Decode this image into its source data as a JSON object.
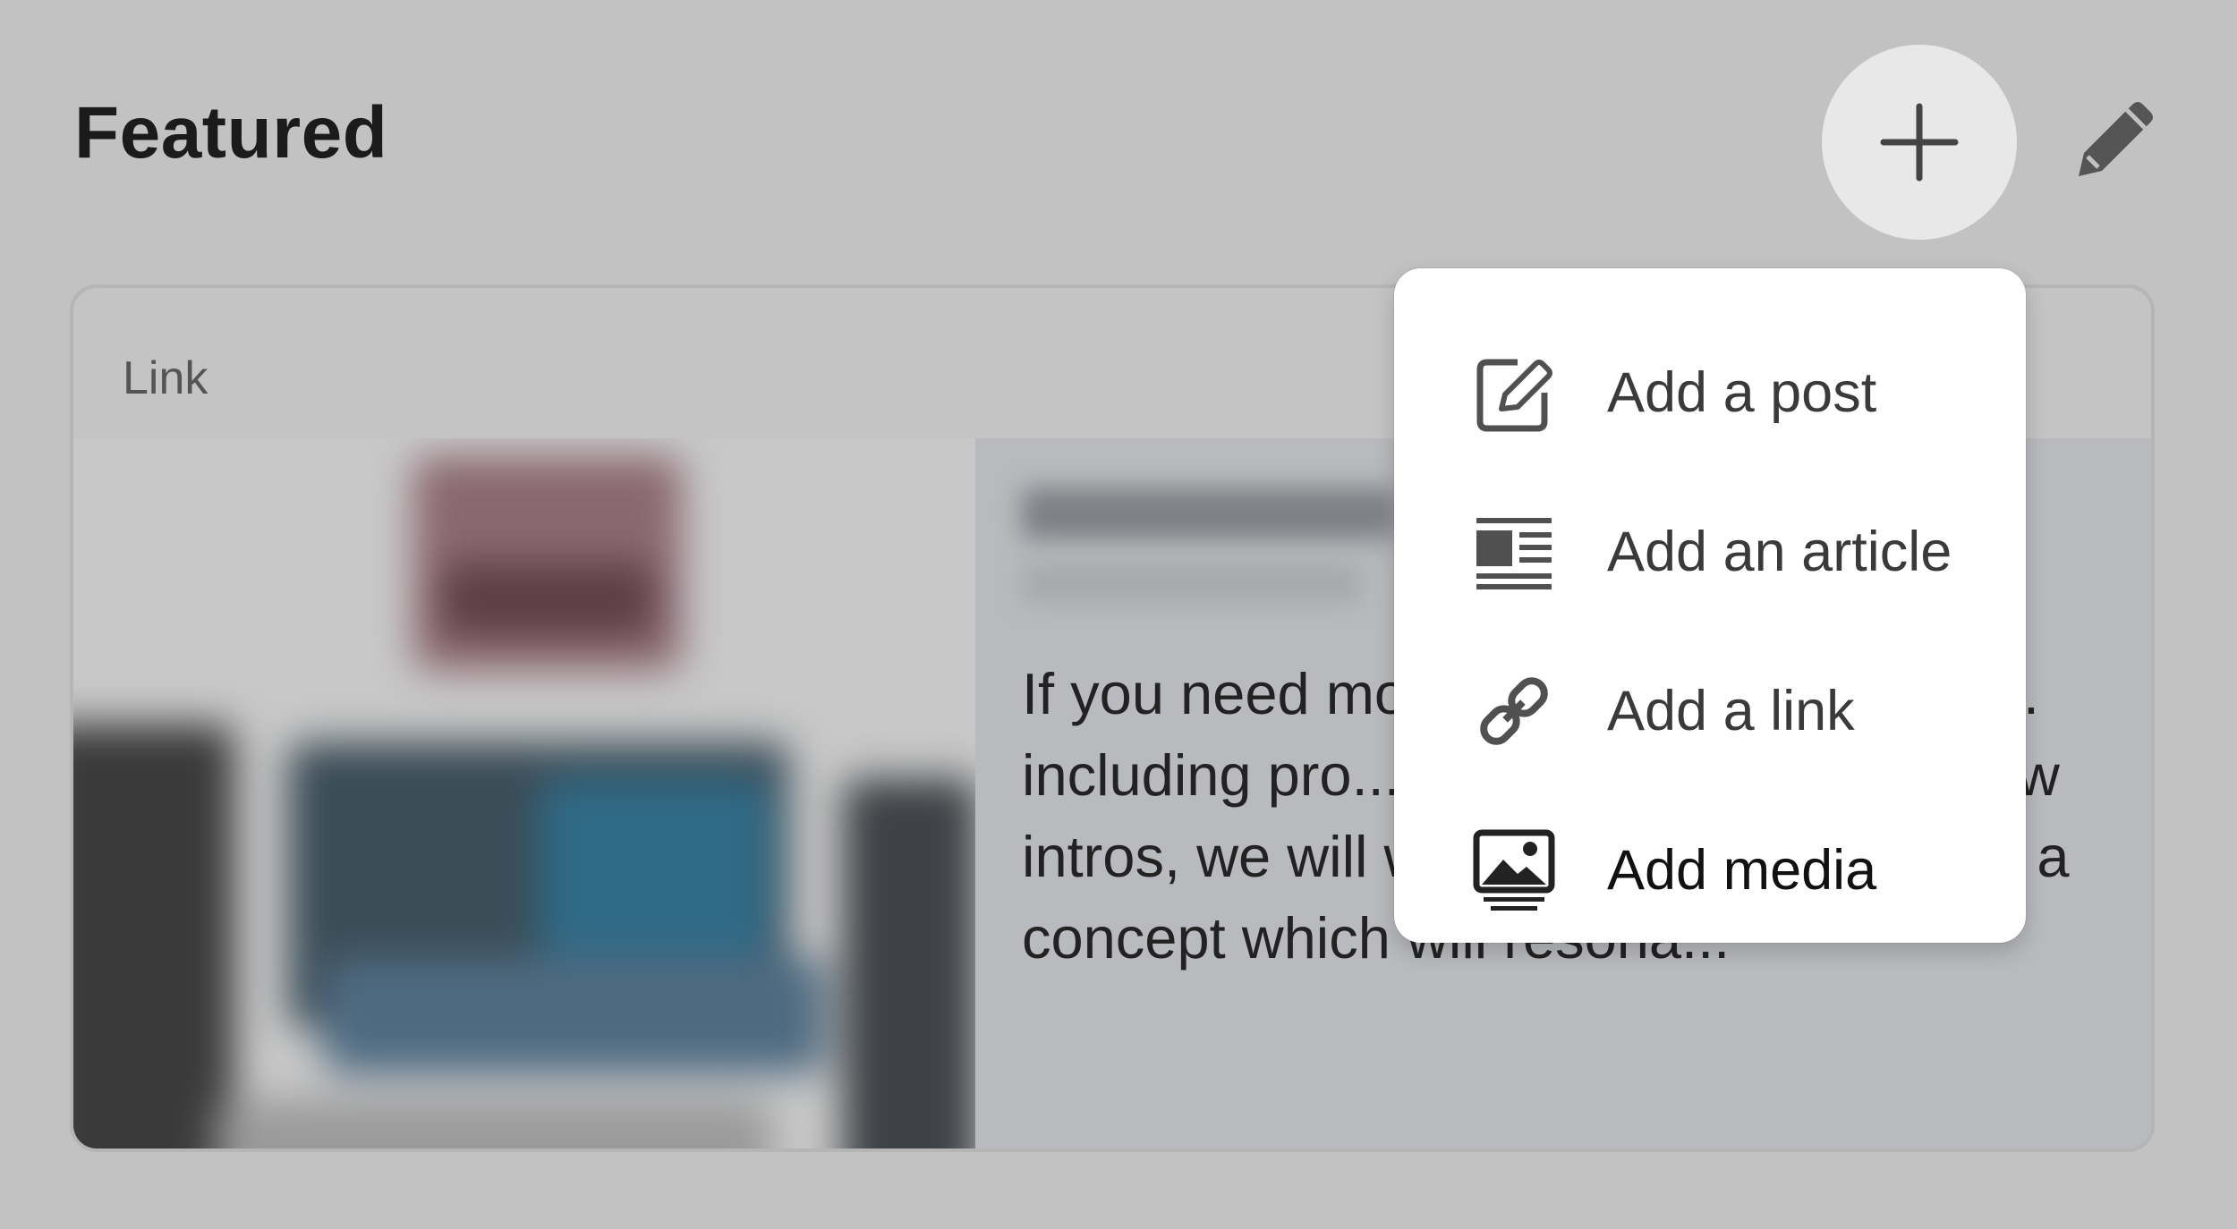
{
  "section": {
    "title": "Featured"
  },
  "toolbar": {
    "add_icon": "plus-icon",
    "edit_icon": "pencil-icon"
  },
  "card": {
    "label": "Link",
    "description": "If you need more... can be used in a v... including pro... les videos, explai... show intros, we will work with you to develop a concept which will resona..."
  },
  "menu": {
    "items": [
      {
        "label": "Add a post",
        "icon": "edit-square-icon"
      },
      {
        "label": "Add an article",
        "icon": "article-icon"
      },
      {
        "label": "Add a link",
        "icon": "link-icon"
      },
      {
        "label": "Add media",
        "icon": "image-icon"
      }
    ]
  }
}
